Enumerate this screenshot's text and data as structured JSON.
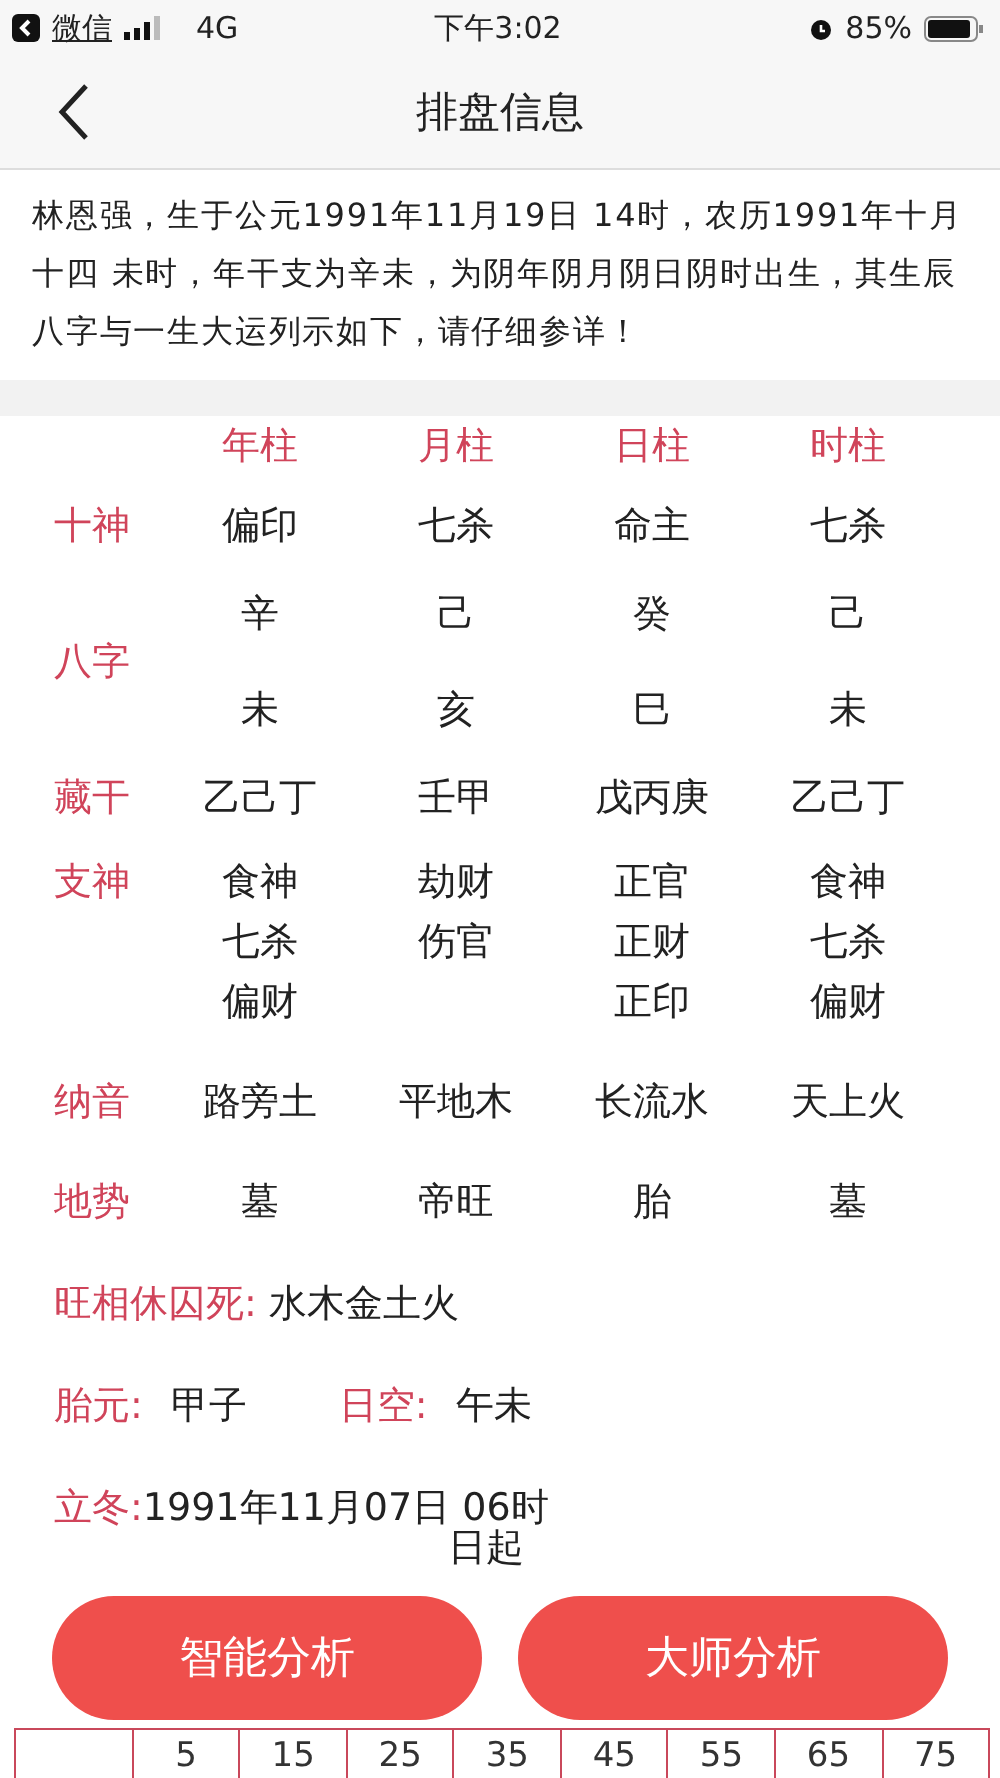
{
  "status_bar": {
    "back_app": "微信",
    "network": "4G",
    "time": "下午3:02",
    "battery": "85%"
  },
  "nav": {
    "title": "排盘信息"
  },
  "intro": "林恩强，生于公元1991年11月19日 14时，农历1991年十月十四  未时，年干支为辛未，为阴年阴月阴日阴时出生，其生辰八字与一生大运列示如下，请仔细参详！",
  "pillars": [
    "年柱",
    "月柱",
    "日柱",
    "时柱"
  ],
  "rows": [
    {
      "label": "十神",
      "kind": "single",
      "cells": [
        [
          "偏印"
        ],
        [
          "七杀"
        ],
        [
          "命主"
        ],
        [
          "七杀"
        ]
      ]
    },
    {
      "label": "八字",
      "kind": "pair",
      "cells": [
        [
          "辛",
          "未"
        ],
        [
          "己",
          "亥"
        ],
        [
          "癸",
          "巳"
        ],
        [
          "己",
          "未"
        ]
      ]
    },
    {
      "label": "藏干",
      "kind": "single",
      "cells": [
        [
          "乙己丁"
        ],
        [
          "壬甲"
        ],
        [
          "戊丙庚"
        ],
        [
          "乙己丁"
        ]
      ]
    },
    {
      "label": "支神",
      "kind": "list",
      "cells": [
        [
          "食神",
          "七杀",
          "偏财"
        ],
        [
          "劫财",
          "伤官"
        ],
        [
          "正官",
          "正财",
          "正印"
        ],
        [
          "食神",
          "七杀",
          "偏财"
        ]
      ]
    },
    {
      "label": "纳音",
      "kind": "single",
      "cells": [
        [
          "路旁土"
        ],
        [
          "平地木"
        ],
        [
          "长流水"
        ],
        [
          "天上火"
        ]
      ]
    },
    {
      "label": "地势",
      "kind": "single",
      "cells": [
        [
          "墓"
        ],
        [
          "帝旺"
        ],
        [
          "胎"
        ],
        [
          "墓"
        ]
      ]
    }
  ],
  "wangxiang": {
    "label": "旺相休囚死:",
    "value": "水木金土火"
  },
  "taiyuan": {
    "label": "胎元:",
    "value": "甲子"
  },
  "rikong": {
    "label": "日空:",
    "value": "午未"
  },
  "lidong": {
    "label": "立冬:",
    "value": "1991年11月07日 06时"
  },
  "hidden_line_fragment": "日起",
  "buttons": [
    "智能分析",
    "大师分析"
  ],
  "dayun_ages": [
    "5",
    "15",
    "25",
    "35",
    "45",
    "55",
    "65",
    "75"
  ]
}
